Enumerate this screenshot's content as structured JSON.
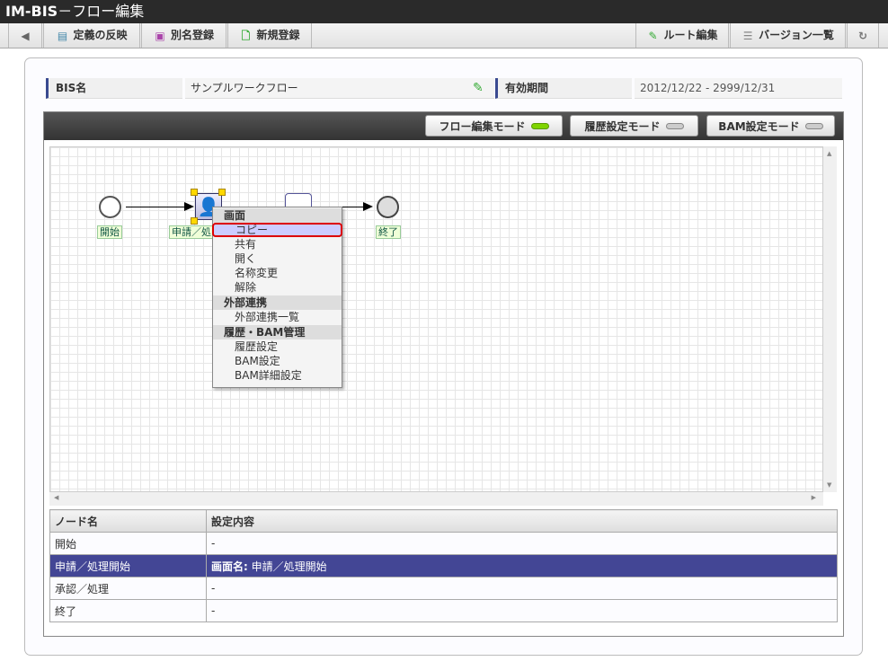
{
  "title": {
    "app": "IM-BIS",
    "sub": "－フロー編集"
  },
  "toolbar": {
    "reflect": "定義の反映",
    "alias": "別名登録",
    "new": "新規登録",
    "route": "ルート編集",
    "versions": "バージョン一覧"
  },
  "info": {
    "bis_label": "BIS名",
    "bis_value": "サンプルワークフロー",
    "period_label": "有効期間",
    "period_value": "2012/12/22 - 2999/12/31"
  },
  "modes": [
    {
      "label": "フロー編集モード",
      "active": true
    },
    {
      "label": "履歴設定モード",
      "active": false
    },
    {
      "label": "BAM設定モード",
      "active": false
    }
  ],
  "nodes": {
    "start": "開始",
    "task1": "申請／処",
    "end": "終了"
  },
  "menu": {
    "h1": "画面",
    "copy": "コピー",
    "share": "共有",
    "open": "開く",
    "rename": "名称変更",
    "release": "解除",
    "h2": "外部連携",
    "ext_list": "外部連携一覧",
    "h3": "履歴・BAM管理",
    "history": "履歴設定",
    "bam": "BAM設定",
    "bam_detail": "BAM詳細設定"
  },
  "table": {
    "headers": [
      "ノード名",
      "設定内容"
    ],
    "rows": [
      {
        "name": "開始",
        "content": "-"
      },
      {
        "name": "申請／処理開始",
        "content_key": "画面名:",
        "content": " 申請／処理開始"
      },
      {
        "name": "承認／処理",
        "content": "-"
      },
      {
        "name": "終了",
        "content": "-"
      }
    ]
  }
}
